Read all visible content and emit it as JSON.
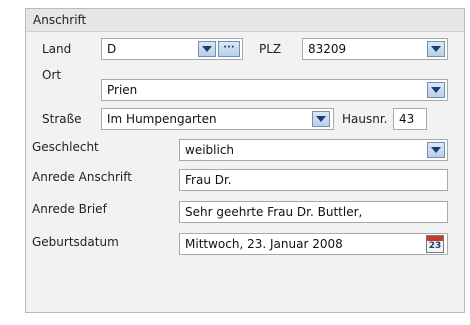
{
  "panel": {
    "title": "Anschrift"
  },
  "labels": {
    "land": "Land",
    "plz": "PLZ",
    "ort": "Ort",
    "strasse": "Straße",
    "hausnr": "Hausnr.",
    "geschlecht": "Geschlecht",
    "anrede_anschrift": "Anrede Anschrift",
    "anrede_brief": "Anrede Brief",
    "geburtsdatum": "Geburtsdatum"
  },
  "values": {
    "land": "D",
    "plz": "83209",
    "ort": "Prien",
    "strasse": "Im Humpengarten",
    "hausnr": "43",
    "geschlecht": "weiblich",
    "anrede_anschrift": "Frau Dr.",
    "anrede_brief": "Sehr geehrte Frau Dr. Buttler,",
    "geburtsdatum": "Mittwoch, 23. Januar 2008"
  },
  "buttons": {
    "more_label": "···"
  },
  "calendar": {
    "day": "23"
  },
  "icons": {
    "dropdown": "chevron-down-icon",
    "more": "ellipsis-icon",
    "calendar": "calendar-icon"
  },
  "colors": {
    "panel_bg": "#f2f2f2",
    "header_bg": "#e6e6e6",
    "button_blue": "#b9cfe9",
    "calendar_red": "#c43a2b"
  }
}
